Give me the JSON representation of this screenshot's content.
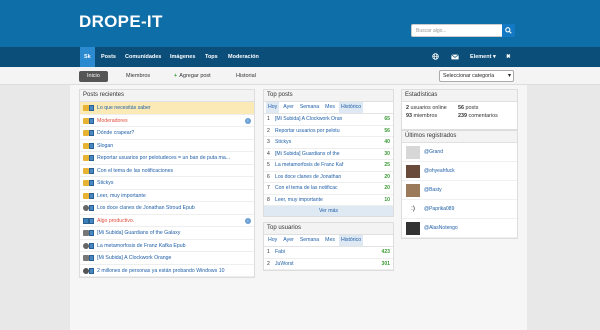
{
  "header": {
    "logo": "DROPE-IT",
    "search_placeholder": "Buscar algo..."
  },
  "nav": {
    "items": [
      "Sk",
      "Posts",
      "Comunidades",
      "Imágenes",
      "Tops",
      "Moderación"
    ],
    "user_label": "Element",
    "caret": "▾",
    "close_glyph": "✖"
  },
  "subnav": {
    "tabs": [
      "Inicio",
      "Miembros",
      "Agregar post",
      "Historial"
    ],
    "plus": "+",
    "category_select": "Seleccionar categoría"
  },
  "recent_posts": {
    "title": "Posts recientes",
    "items": [
      {
        "text": "Lo que necesitás saber",
        "icon": "lock",
        "highlight": true,
        "red": false,
        "info": false
      },
      {
        "text": "Moderadores",
        "icon": "lock",
        "highlight": false,
        "red": true,
        "info": true
      },
      {
        "text": "Dónde crapear?",
        "icon": "lock",
        "highlight": false,
        "red": false,
        "info": false
      },
      {
        "text": "Slogan",
        "icon": "lock",
        "highlight": false,
        "red": false,
        "info": false
      },
      {
        "text": "Reportar usuarios por pelotudeces = un ban de puta ma...",
        "icon": "lock",
        "highlight": false,
        "red": false,
        "info": false
      },
      {
        "text": "Con el tema de las notificaciones",
        "icon": "lock",
        "highlight": false,
        "red": false,
        "info": false
      },
      {
        "text": "Stickys",
        "icon": "lock",
        "highlight": false,
        "red": false,
        "info": false
      },
      {
        "text": "Leer, muy importante",
        "icon": "lock",
        "highlight": false,
        "red": false,
        "info": false
      },
      {
        "text": "Los doce clanes de Jonathan Stroud Epub",
        "icon": "cloud",
        "highlight": false,
        "red": false,
        "info": false
      },
      {
        "text": "Algo productivo.",
        "icon": "doc",
        "highlight": false,
        "red": true,
        "info": true
      },
      {
        "text": "[Mi Subida] Guardians of the Galaxy",
        "icon": "gray",
        "highlight": false,
        "red": false,
        "info": false
      },
      {
        "text": "La metamorfosis de Franz Kafka Epub",
        "icon": "cloud",
        "highlight": false,
        "red": false,
        "info": false
      },
      {
        "text": "[Mi Subida] A Clockwork Orange",
        "icon": "gray",
        "highlight": false,
        "red": false,
        "info": false
      },
      {
        "text": "2 millones de personas ya están probando Windows 10",
        "icon": "gear",
        "highlight": false,
        "red": false,
        "info": false
      }
    ]
  },
  "top_posts": {
    "title": "Top posts",
    "filters": [
      "Hoy",
      "Ayer",
      "Semana",
      "Mes",
      "Histórico"
    ],
    "items": [
      {
        "n": "1",
        "text": "[Mi Subida] A Clockwork Oran",
        "score": "65"
      },
      {
        "n": "2",
        "text": "Reportar usuarios por pelotu",
        "score": "56"
      },
      {
        "n": "3",
        "text": "Stickys",
        "score": "40"
      },
      {
        "n": "4",
        "text": "[Mi Subida] Guardians of the",
        "score": "30"
      },
      {
        "n": "5",
        "text": "La metamorfosis de Franz Kaf",
        "score": "25"
      },
      {
        "n": "6",
        "text": "Los doce clanes de Jonathan",
        "score": "20"
      },
      {
        "n": "7",
        "text": "Con el tema de las notificac",
        "score": "20"
      },
      {
        "n": "8",
        "text": "Leer, muy importante",
        "score": "10"
      }
    ],
    "more": "Ver más"
  },
  "top_users": {
    "title": "Top usuarios",
    "filters": [
      "Hoy",
      "Ayer",
      "Semana",
      "Mes",
      "Histórico"
    ],
    "items": [
      {
        "n": "1",
        "text": "Fabi",
        "score": "423"
      },
      {
        "n": "2",
        "text": "JuWorst",
        "score": "301"
      }
    ]
  },
  "stats": {
    "title": "Estadísticas",
    "online_count": "2",
    "online_label": "usuarios online",
    "posts_count": "56",
    "posts_label": "posts",
    "members_count": "93",
    "members_label": "miembros",
    "comments_count": "239",
    "comments_label": "comentarios"
  },
  "registered": {
    "title": "Últimos registrados",
    "users": [
      "@Grand",
      "@ohyeahfuck",
      "@Basty",
      "@Paprika089",
      "@AlasNotengo"
    ]
  }
}
